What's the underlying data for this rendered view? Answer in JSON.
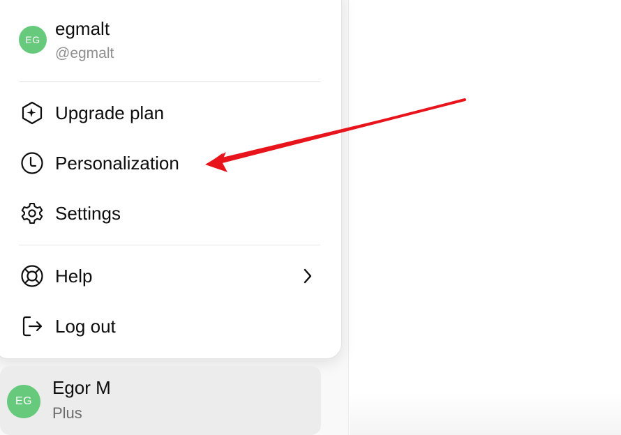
{
  "profile": {
    "avatar_initials": "EG",
    "name": "egmalt",
    "handle": "@egmalt"
  },
  "menu": {
    "items": [
      {
        "label": "Upgrade plan",
        "icon": "upgrade-sparkle-icon"
      },
      {
        "label": "Personalization",
        "icon": "personalization-icon"
      },
      {
        "label": "Settings",
        "icon": "gear-icon"
      },
      {
        "label": "Help",
        "icon": "lifebuoy-icon",
        "has_submenu": true
      },
      {
        "label": "Log out",
        "icon": "logout-icon"
      }
    ]
  },
  "account": {
    "avatar_initials": "EG",
    "name": "Egor M",
    "plan": "Plus"
  },
  "colors": {
    "avatar_bg": "#67c97c",
    "annotation_arrow": "#e8141c"
  }
}
